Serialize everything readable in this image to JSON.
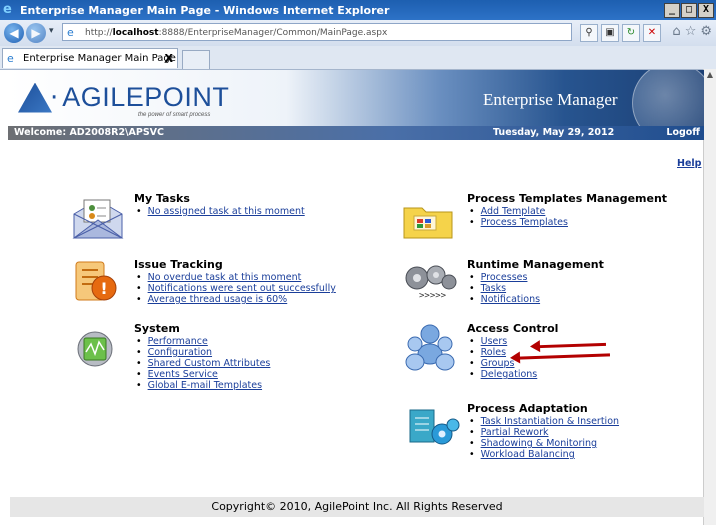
{
  "window": {
    "title": "Enterprise Manager Main Page - Windows Internet Explorer",
    "controls": [
      "_",
      "□",
      "X"
    ]
  },
  "address": {
    "prefix": "http://",
    "host": "localhost",
    "rest": ":8888/EnterpriseManager/Common/MainPage.aspx"
  },
  "tab": {
    "label": "Enterprise Manager Main Page",
    "close": "X"
  },
  "banner": {
    "brand": "AGILEPOINT",
    "tagline": "the power of smart process",
    "title": "Enterprise Manager"
  },
  "welcome": {
    "user": "Welcome: AD2008R2\\APSVC",
    "date": "Tuesday, May 29, 2012",
    "logoff": "Logoff"
  },
  "help": "Help",
  "sections": {
    "my_tasks": {
      "title": "My Tasks",
      "items": [
        "No assigned task at this moment"
      ]
    },
    "issue_tracking": {
      "title": "Issue Tracking",
      "items": [
        "No overdue task at this moment",
        "Notifications were sent out successfully",
        "Average thread usage is 60%"
      ]
    },
    "system": {
      "title": "System",
      "items": [
        "Performance",
        "Configuration",
        "Shared Custom Attributes",
        "Events Service",
        "Global E-mail Templates"
      ]
    },
    "process_templates": {
      "title": "Process Templates Management",
      "items": [
        "Add Template",
        "Process Templates"
      ]
    },
    "runtime": {
      "title": "Runtime Management",
      "items": [
        "Processes",
        "Tasks",
        "Notifications"
      ]
    },
    "access_control": {
      "title": "Access Control",
      "items": [
        "Users",
        "Roles",
        "Groups",
        "Delegations"
      ]
    },
    "process_adaptation": {
      "title": "Process Adaptation",
      "items": [
        "Task Instantiation & Insertion",
        "Partial Rework",
        "Shadowing & Monitoring",
        "Workload Balancing"
      ]
    }
  },
  "footer": "Copyright© 2010, AgilePoint Inc. All Rights Reserved",
  "colors": {
    "link": "#1a3e9a",
    "arrow": "#b30000",
    "titlebar": "#1d5fb0"
  }
}
